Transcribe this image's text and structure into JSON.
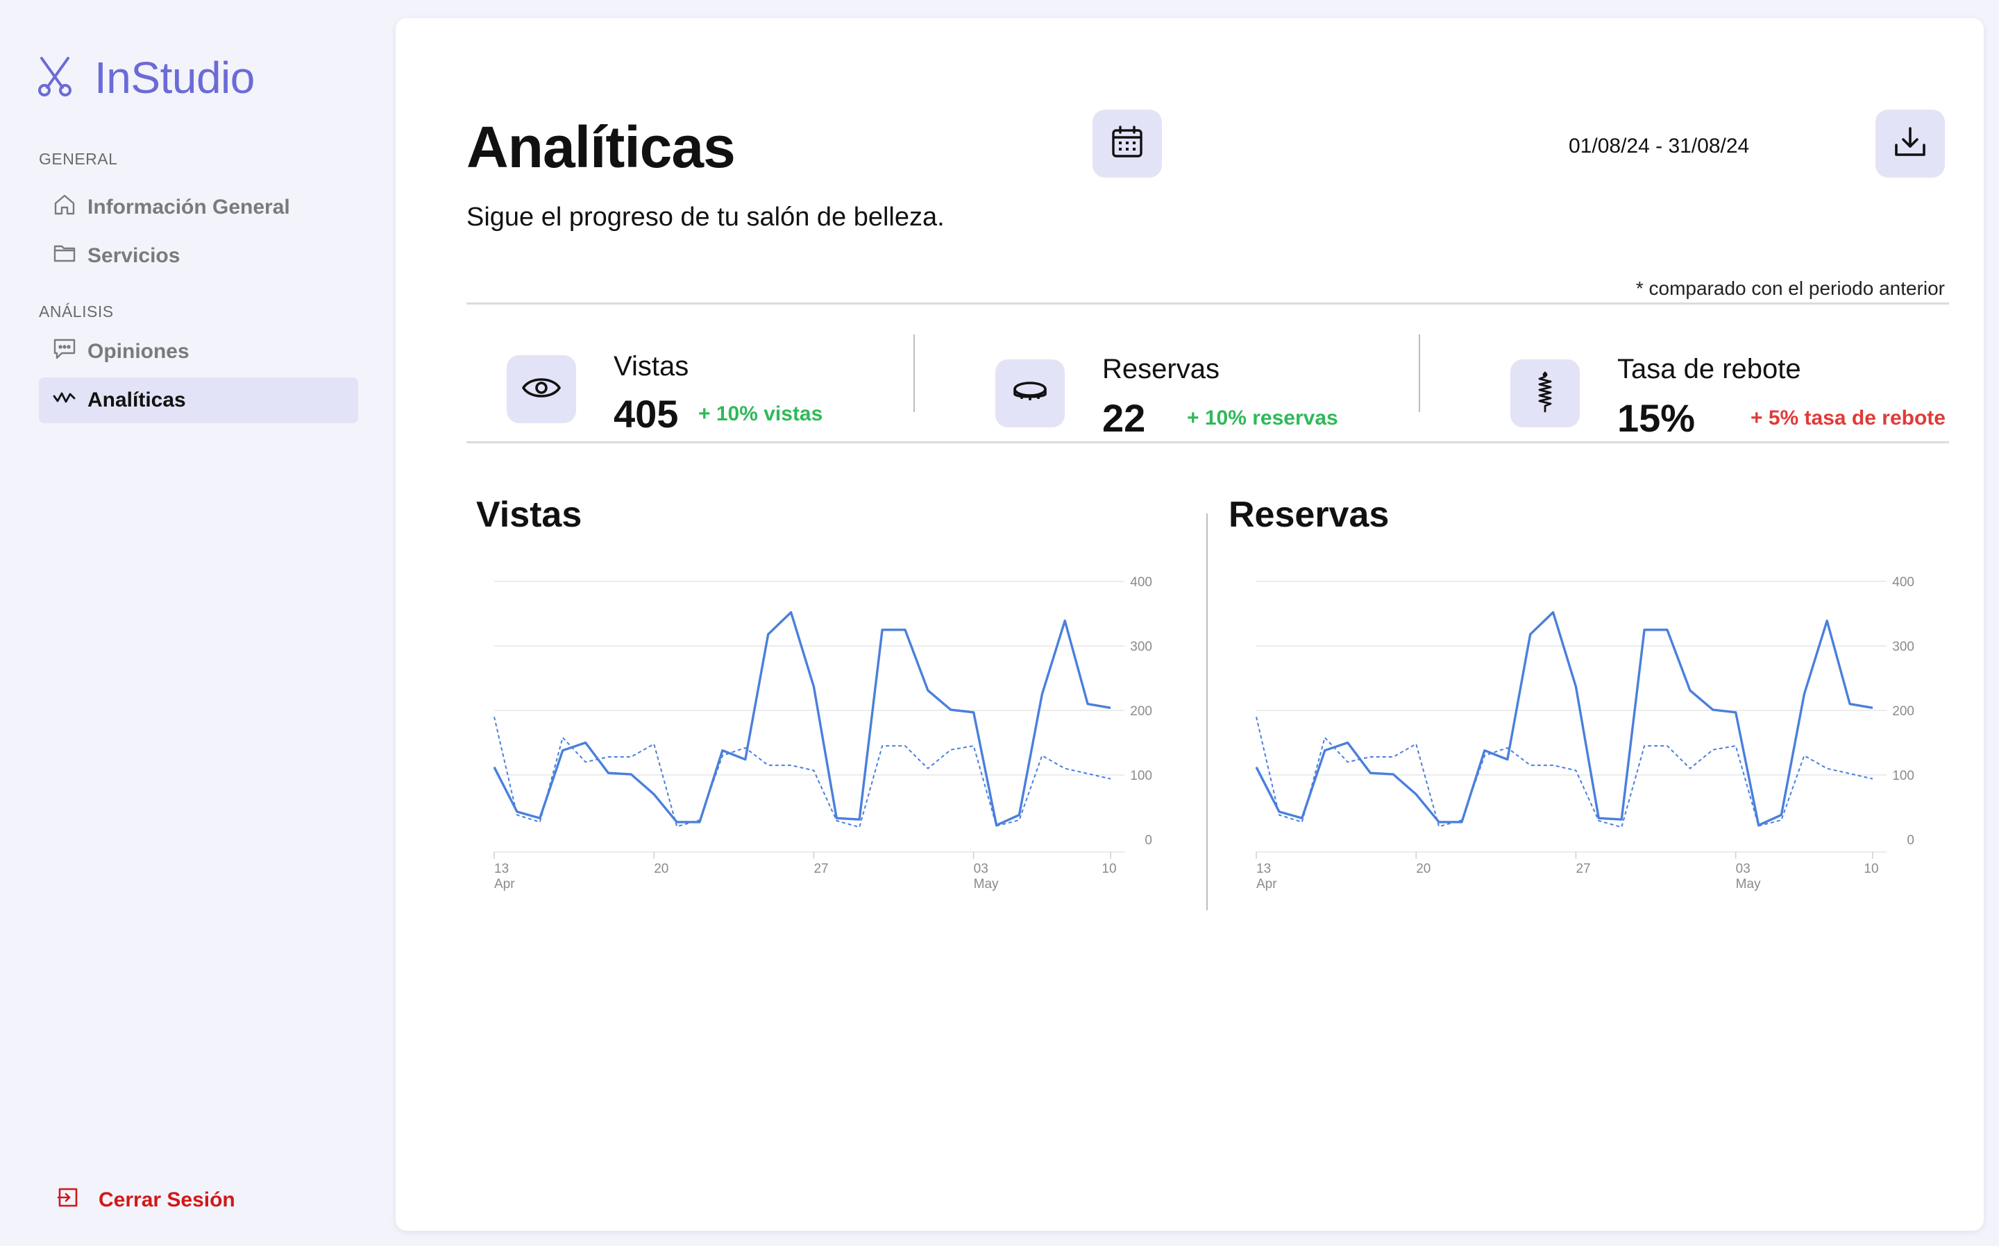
{
  "app": {
    "name": "InStudio"
  },
  "sidebar": {
    "sections": [
      {
        "label": "GENERAL",
        "items": [
          {
            "label": "Información General",
            "icon": "home-icon",
            "active": false
          },
          {
            "label": "Servicios",
            "icon": "folder-icon",
            "active": false
          }
        ]
      },
      {
        "label": "ANÁLISIS",
        "items": [
          {
            "label": "Opiniones",
            "icon": "chat-icon",
            "active": false
          },
          {
            "label": "Analíticas",
            "icon": "activity-icon",
            "active": true
          }
        ]
      }
    ],
    "logout_label": "Cerrar Sesión"
  },
  "header": {
    "title": "Analíticas",
    "subtitle": "Sigue el progreso de tu salón de belleza.",
    "date_range": "01/08/24 - 31/08/24",
    "compare_note": "* comparado con el periodo anterior"
  },
  "stats": [
    {
      "label": "Vistas",
      "value": "405",
      "delta": "+ 10% vistas",
      "trend": "up",
      "icon": "eye-icon"
    },
    {
      "label": "Reservas",
      "value": "22",
      "delta": "+ 10% reservas",
      "trend": "up",
      "icon": "coin-icon"
    },
    {
      "label": "Tasa de rebote",
      "value": "15%",
      "delta": "+ 5% tasa de rebote",
      "trend": "down",
      "icon": "spring-icon"
    }
  ],
  "colors": {
    "accent": "#6b6bd6",
    "accent_bg": "#e2e3f6",
    "positive": "#2fb95a",
    "negative": "#e03a3a",
    "logout": "#d01818",
    "series": "#4a7fdc"
  },
  "chart_data": [
    {
      "type": "line",
      "title": "Vistas",
      "ylim": [
        0,
        400
      ],
      "yticks": [
        "400",
        "300",
        "200",
        "100",
        "0"
      ],
      "xticks": [
        {
          "day": "13",
          "month": "Apr"
        },
        {
          "day": "20",
          "month": ""
        },
        {
          "day": "27",
          "month": ""
        },
        {
          "day": "03",
          "month": "May"
        },
        {
          "day": "10",
          "month": ""
        }
      ],
      "grid": true,
      "legend": "none",
      "series": [
        {
          "style": "solid",
          "values": [
            112,
            43,
            33,
            138,
            150,
            103,
            101,
            70,
            27,
            27,
            138,
            124,
            318,
            352,
            237,
            33,
            31,
            325,
            325,
            231,
            201,
            197,
            22,
            38,
            225,
            339,
            210,
            204
          ]
        },
        {
          "style": "dashed",
          "values": [
            190,
            38,
            27,
            158,
            120,
            128,
            128,
            148,
            20,
            30,
            130,
            142,
            115,
            115,
            107,
            29,
            19,
            145,
            145,
            110,
            139,
            145,
            21,
            30,
            130,
            110,
            102,
            94
          ]
        }
      ]
    },
    {
      "type": "line",
      "title": "Reservas",
      "ylim": [
        0,
        400
      ],
      "yticks": [
        "400",
        "300",
        "200",
        "100",
        "0"
      ],
      "xticks": [
        {
          "day": "13",
          "month": "Apr"
        },
        {
          "day": "20",
          "month": ""
        },
        {
          "day": "27",
          "month": ""
        },
        {
          "day": "03",
          "month": "May"
        },
        {
          "day": "10",
          "month": ""
        }
      ],
      "grid": true,
      "legend": "none",
      "series": [
        {
          "style": "solid",
          "values": [
            112,
            43,
            33,
            138,
            150,
            103,
            101,
            70,
            27,
            27,
            138,
            124,
            318,
            352,
            237,
            33,
            31,
            325,
            325,
            231,
            201,
            197,
            22,
            38,
            225,
            339,
            210,
            204
          ]
        },
        {
          "style": "dashed",
          "values": [
            190,
            38,
            27,
            158,
            120,
            128,
            128,
            148,
            20,
            30,
            130,
            142,
            115,
            115,
            107,
            29,
            19,
            145,
            145,
            110,
            139,
            145,
            21,
            30,
            130,
            110,
            102,
            94
          ]
        }
      ]
    }
  ]
}
